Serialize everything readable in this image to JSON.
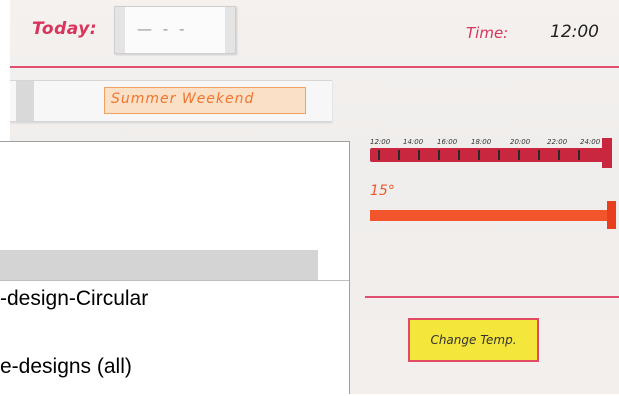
{
  "prototype": {
    "today_label": "Today:",
    "date_text": "— - -",
    "time_label": "Time:",
    "time_value": "12:00",
    "mode_label": "Summer Weekend",
    "timeline_ticks": [
      "12:00",
      "14:00",
      "16:00",
      "18:00",
      "20:00",
      "22:00",
      "24:00"
    ],
    "temperature_label": "15°",
    "change_temp_button": "Change Temp."
  },
  "overlay": {
    "list_items": [
      "-design-Circular",
      "e-designs (all)"
    ]
  },
  "colors": {
    "accent_pink": "#d8345c",
    "orange": "#f2542c",
    "red_bar": "#c8273f",
    "button_yellow": "#f4e63a"
  }
}
